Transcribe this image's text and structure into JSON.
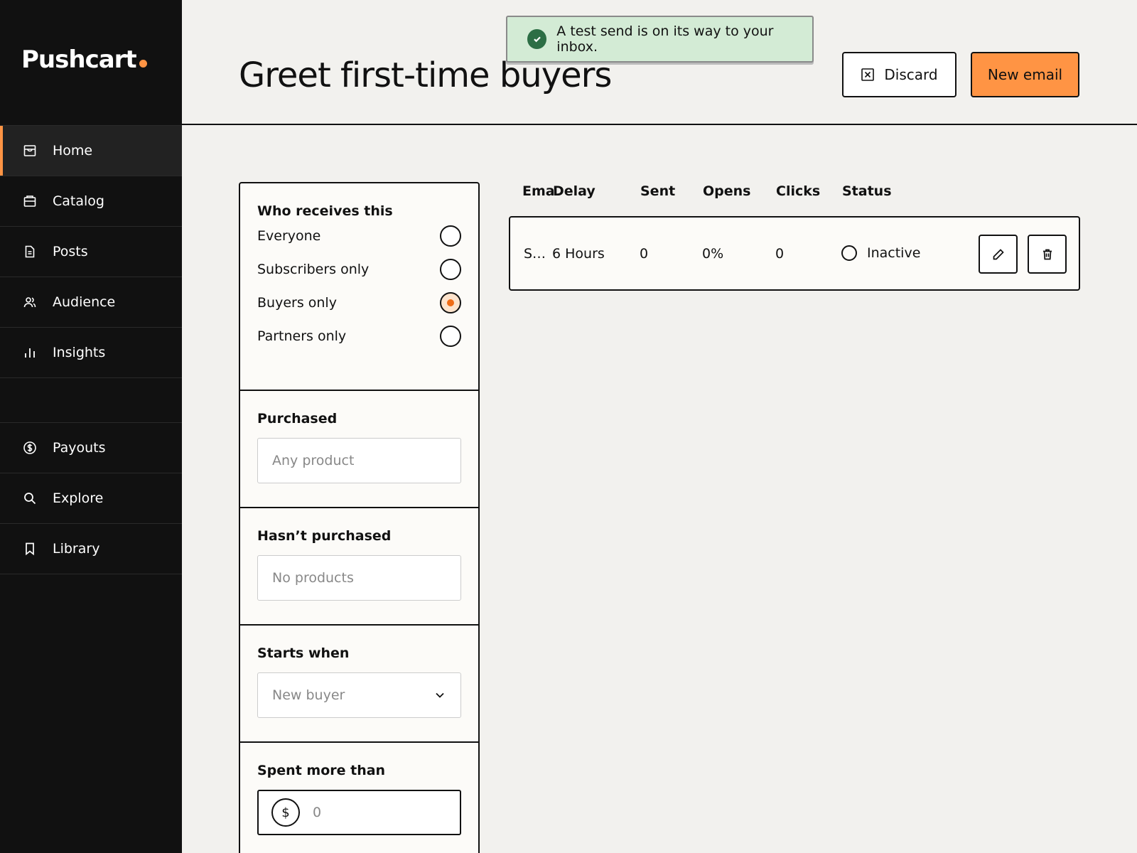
{
  "app": {
    "name": "Pushcart"
  },
  "sidebar": {
    "items": [
      {
        "label": "Home",
        "icon": "store-icon",
        "active": true
      },
      {
        "label": "Catalog",
        "icon": "archive-icon"
      },
      {
        "label": "Posts",
        "icon": "document-icon"
      },
      {
        "label": "Audience",
        "icon": "users-icon"
      },
      {
        "label": "Insights",
        "icon": "bar-chart-icon"
      }
    ],
    "bottom_items": [
      {
        "label": "Payouts",
        "icon": "dollar-circle-icon"
      },
      {
        "label": "Explore",
        "icon": "search-icon"
      },
      {
        "label": "Library",
        "icon": "bookmark-icon"
      }
    ]
  },
  "header": {
    "title": "Greet first-time buyers",
    "discard_label": "Discard",
    "new_email_label": "New email"
  },
  "toast": {
    "message": "A test send is on its way to your inbox."
  },
  "filters": {
    "who": {
      "title": "Who receives this",
      "options": [
        "Everyone",
        "Subscribers only",
        "Buyers only",
        "Partners only"
      ],
      "selected": "Buyers only"
    },
    "purchased": {
      "title": "Purchased",
      "placeholder": "Any product"
    },
    "not_purchased": {
      "title": "Hasn’t purchased",
      "placeholder": "No products"
    },
    "starts_when": {
      "title": "Starts when",
      "value": "New buyer"
    },
    "spent": {
      "title": "Spent more than",
      "currency": "$",
      "value": "0"
    }
  },
  "table": {
    "columns": [
      "Email",
      "Delay",
      "Sent",
      "Opens",
      "Clicks",
      "Status"
    ],
    "rows": [
      {
        "email": "S…",
        "delay": "6 Hours",
        "sent": "0",
        "opens": "0%",
        "clicks": "0",
        "status": "Inactive"
      }
    ]
  },
  "colors": {
    "accent": "#ff9444",
    "sidebar": "#111111",
    "toast_bg": "#d3ebd5",
    "success": "#2c6e45"
  }
}
